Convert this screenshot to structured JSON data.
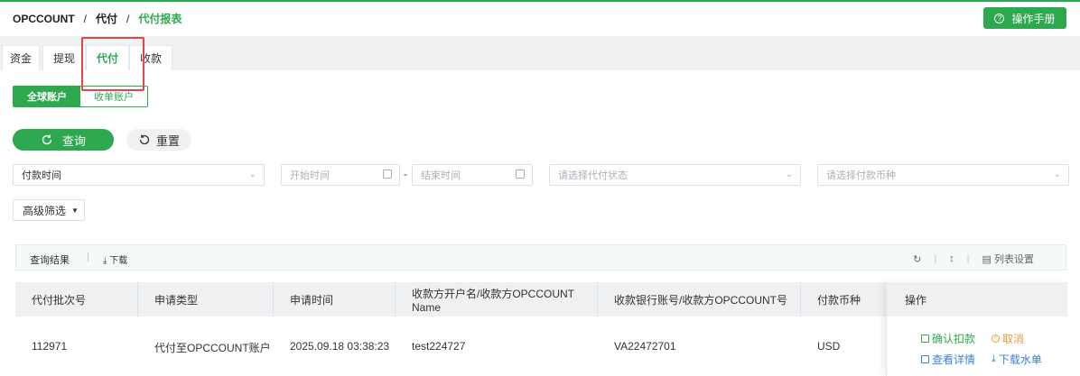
{
  "breadcrumb": {
    "root": "OPCCOUNT",
    "level2": "代付",
    "level3": "代付报表",
    "separator": "/"
  },
  "header": {
    "manual_button": "操作手册"
  },
  "tabs": [
    {
      "label": "资金"
    },
    {
      "label": "提现"
    },
    {
      "label": "代付"
    },
    {
      "label": "收款"
    }
  ],
  "account_toggle": {
    "global": "全球账户",
    "collection": "收单账户"
  },
  "actions": {
    "search": "查询",
    "reset": "重置"
  },
  "filters": {
    "time_type": "付款时间",
    "start_placeholder": "开始时间",
    "range_dash": "-",
    "end_placeholder": "结束时间",
    "status_placeholder": "请选择代付状态",
    "currency_placeholder": "请选择付款币种",
    "advanced": "高级筛选"
  },
  "result_bar": {
    "label": "查询结果",
    "separator": "|",
    "download": "下载",
    "column_settings": "列表设置"
  },
  "table": {
    "columns": [
      "代付批次号",
      "申请类型",
      "申请时间",
      "收款方开户名/收款方OPCCOUNT Name",
      "收款银行账号/收款方OPCCOUNT号",
      "付款币种",
      "操作"
    ],
    "rows": [
      {
        "batch_no": "112971",
        "apply_type": "代付至OPCCOUNT账户",
        "apply_time": "2025.09.18 03:38:23",
        "payee_name": "test224727",
        "payee_account": "VA22472701",
        "currency": "USD"
      }
    ]
  },
  "row_actions": {
    "confirm": "确认扣款",
    "cancel": "取消",
    "details": "查看详情",
    "download_receipt": "下载水单"
  },
  "colors": {
    "brand_green": "#2ea84f",
    "highlight_red": "#e8424b",
    "cancel_orange": "#e89a3c",
    "link_blue": "#3a82d4"
  }
}
